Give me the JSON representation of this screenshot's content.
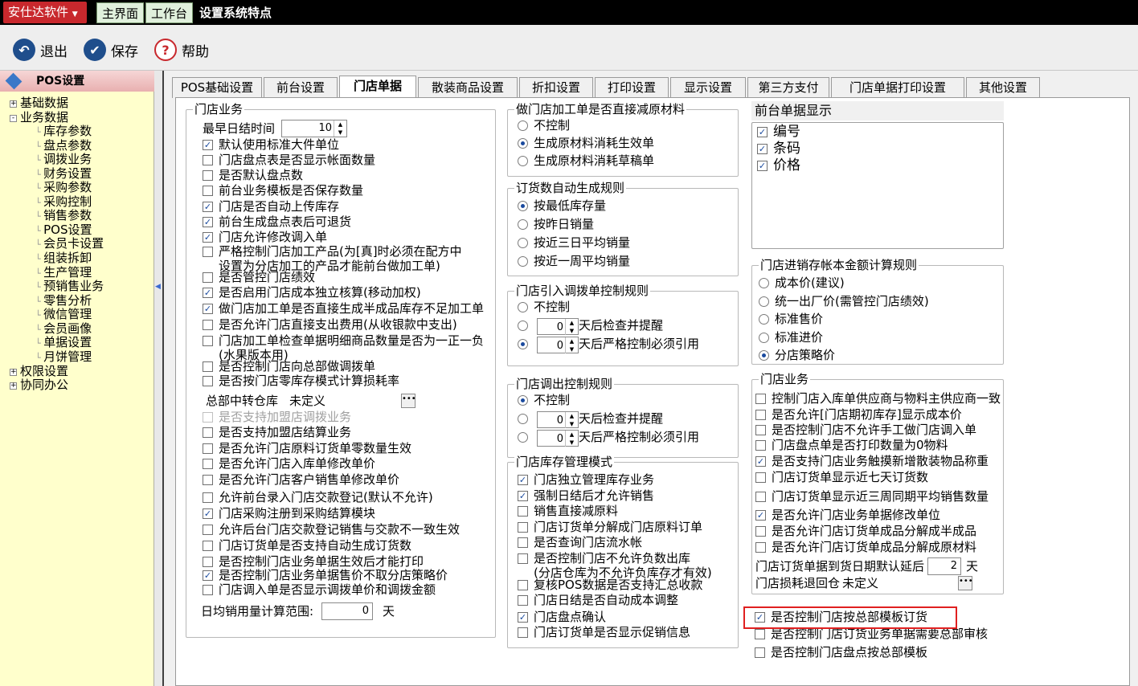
{
  "brand": "安仕达软件",
  "top_tabs": [
    "主界面",
    "工作台",
    "设置系统特点"
  ],
  "toolbar": {
    "exit": "退出",
    "save": "保存",
    "help": "帮助"
  },
  "left_panel": {
    "title": "POS设置",
    "tree": [
      {
        "label": "基础数据",
        "expander": "+",
        "level": 0
      },
      {
        "label": "业务数据",
        "expander": "-",
        "level": 0
      },
      {
        "label": "库存参数",
        "level": 1
      },
      {
        "label": "盘点参数",
        "level": 1
      },
      {
        "label": "调拨业务",
        "level": 1
      },
      {
        "label": "财务设置",
        "level": 1
      },
      {
        "label": "采购参数",
        "level": 1
      },
      {
        "label": "采购控制",
        "level": 1
      },
      {
        "label": "销售参数",
        "level": 1
      },
      {
        "label": "POS设置",
        "level": 1
      },
      {
        "label": "会员卡设置",
        "level": 1
      },
      {
        "label": "组装拆卸",
        "level": 1
      },
      {
        "label": "生产管理",
        "level": 1
      },
      {
        "label": "预销售业务",
        "level": 1
      },
      {
        "label": "零售分析",
        "level": 1
      },
      {
        "label": "微信管理",
        "level": 1
      },
      {
        "label": "会员画像",
        "level": 1
      },
      {
        "label": "单据设置",
        "level": 1
      },
      {
        "label": "月饼管理",
        "level": 1
      },
      {
        "label": "权限设置",
        "expander": "+",
        "level": 0
      },
      {
        "label": "协同办公",
        "expander": "+",
        "level": 0
      }
    ]
  },
  "tabs": [
    "POS基础设置",
    "前台设置",
    "门店单据",
    "散装商品设置",
    "折扣设置",
    "打印设置",
    "显示设置",
    "第三方支付",
    "门店单据打印设置",
    "其他设置"
  ],
  "active_tab": "门店单据",
  "store_business": {
    "title": "门店业务",
    "earliest_label": "最早日结时间",
    "earliest_value": "10",
    "opts": [
      {
        "t": "默认使用标准大件单位",
        "c": true
      },
      {
        "t": "门店盘点表是否显示帐面数量",
        "c": false
      },
      {
        "t": "是否默认盘点数",
        "c": false
      },
      {
        "t": "前台业务模板是否保存数量",
        "c": false
      },
      {
        "t": "门店是否自动上传库存",
        "c": true
      },
      {
        "t": "前台生成盘点表后可退货",
        "c": true
      },
      {
        "t": "门店允许修改调入单",
        "c": true
      },
      {
        "t": "严格控制门店加工产品(为[真]时必须在配方中\n设置为分店加工的产品才能前台做加工单)",
        "c": false
      },
      {
        "t": "是否管控门店绩效",
        "c": false
      },
      {
        "t": "是否启用门店成本独立核算(移动加权)",
        "c": true
      },
      {
        "t": "做门店加工单是否直接生成半成品库存不足加工单",
        "c": true
      },
      {
        "t": "是否允许门店直接支出费用(从收银款中支出)",
        "c": false
      },
      {
        "t": "门店加工单检查单据明细商品数量是否为一正一负\n(水果版本用)",
        "c": false
      },
      {
        "t": "是否控制门店向总部做调拨单",
        "c": false
      },
      {
        "t": "是否按门店零库存模式计算损耗率",
        "c": false
      }
    ],
    "transit_label": "总部中转仓库",
    "transit_value": "未定义",
    "opts2": [
      {
        "t": "是否支持加盟店调拨业务",
        "c": false,
        "d": true
      },
      {
        "t": "是否支持加盟店结算业务",
        "c": false
      },
      {
        "t": "是否允许门店原料订货单零数量生效",
        "c": false
      },
      {
        "t": "是否允许门店入库单修改单价",
        "c": false
      },
      {
        "t": "是否允许门店客户销售单修改单价",
        "c": false
      },
      {
        "t": "允许前台录入门店交款登记(默认不允许)",
        "c": false
      },
      {
        "t": "门店采购注册到采购结算模块",
        "c": true
      },
      {
        "t": "允许后台门店交款登记销售与交款不一致生效",
        "c": false
      },
      {
        "t": "门店订货单是否支持自动生成订货数",
        "c": false
      },
      {
        "t": "是否控制门店业务单据生效后才能打印",
        "c": false
      },
      {
        "t": "是否控制门店业务单据售价不取分店策略价",
        "c": true
      },
      {
        "t": "门店调入单是否显示调拨单价和调拨金额",
        "c": false
      }
    ],
    "daily_label": "日均销用量计算范围:",
    "daily_value": "0",
    "daily_unit": "天"
  },
  "processing": {
    "title": "做门店加工单是否直接减原材料",
    "opts": [
      {
        "t": "不控制",
        "on": false
      },
      {
        "t": "生成原材料消耗生效单",
        "on": true
      },
      {
        "t": "生成原材料消耗草稿单",
        "on": false
      }
    ]
  },
  "order_rule": {
    "title": "订货数自动生成规则",
    "opts": [
      {
        "t": "按最低库存量",
        "on": true
      },
      {
        "t": "按昨日销量",
        "on": false
      },
      {
        "t": "按近三日平均销量",
        "on": false
      },
      {
        "t": "按近一周平均销量",
        "on": false
      }
    ]
  },
  "transfer_in": {
    "title": "门店引入调拨单控制规则",
    "opt0": "不控制",
    "v1": "0",
    "t1": "天后检查并提醒",
    "v2": "0",
    "t2": "天后严格控制必须引用",
    "sel": 2
  },
  "transfer_out": {
    "title": "门店调出控制规则",
    "opt0": "不控制",
    "v1": "0",
    "t1": "天后检查并提醒",
    "v2": "0",
    "t2": "天后严格控制必须引用",
    "sel": 0
  },
  "inventory_mode": {
    "title": "门店库存管理模式",
    "opts": [
      {
        "t": "门店独立管理库存业务",
        "c": true
      },
      {
        "t": "强制日结后才允许销售",
        "c": true
      },
      {
        "t": "销售直接减原料",
        "c": false
      },
      {
        "t": "门店订货单分解成门店原料订单",
        "c": false
      },
      {
        "t": "是否查询门店流水帐",
        "c": false
      },
      {
        "t": "是否控制门店不允许负数出库\n(分店仓库为不允许负库存才有效)",
        "c": false
      },
      {
        "t": "复核POS数据是否支持汇总收款",
        "c": false
      },
      {
        "t": "门店日结是否自动成本调整",
        "c": false
      },
      {
        "t": "门店盘点确认",
        "c": true
      },
      {
        "t": "门店订货单是否显示促销信息",
        "c": false
      }
    ]
  },
  "front_display": {
    "title": "前台单据显示",
    "items": [
      {
        "t": "编号",
        "c": true
      },
      {
        "t": "条码",
        "c": true
      },
      {
        "t": "价格",
        "c": true
      }
    ]
  },
  "cost_rule": {
    "title": "门店进销存帐本金额计算规则",
    "opts": [
      {
        "t": "成本价(建议)",
        "on": false
      },
      {
        "t": "统一出厂价(需管控门店绩效)",
        "on": false
      },
      {
        "t": "标准售价",
        "on": false
      },
      {
        "t": "标准进价",
        "on": false
      },
      {
        "t": "分店策略价",
        "on": true
      }
    ]
  },
  "store_biz2": {
    "title": "门店业务",
    "opts": [
      {
        "t": "控制门店入库单供应商与物料主供应商一致",
        "c": false
      },
      {
        "t": "是否允许[门店期初库存]显示成本价",
        "c": false
      },
      {
        "t": "是否控制门店不允许手工做门店调入单",
        "c": false
      },
      {
        "t": "门店盘点单是否打印数量为0物料",
        "c": false
      },
      {
        "t": "是否支持门店业务触摸新增散装物品称重",
        "c": true
      },
      {
        "t": "门店订货单显示近七天订货数",
        "c": false
      },
      {
        "t": "门店订货单显示近三周同期平均销售数量",
        "c": false
      },
      {
        "t": "是否允许门店业务单据修改单位",
        "c": true
      },
      {
        "t": "是否允许门店订货单成品分解成半成品",
        "c": false
      },
      {
        "t": "是否允许门店订货单成品分解成原材料",
        "c": false
      }
    ],
    "delay_label": "门店订货单据到货日期默认延后",
    "delay_value": "2",
    "delay_unit": "天",
    "return_label": "门店损耗退回仓",
    "return_value": "未定义"
  },
  "bottom_opts": [
    {
      "t": "是否控制门店按总部模板订货",
      "c": true
    },
    {
      "t": "是否控制门店订货业务单据需要总部审核",
      "c": false
    },
    {
      "t": "是否控制门店盘点按总部模板",
      "c": false
    }
  ],
  "colors": {
    "brand_red": "#c8282d",
    "left_panel_bg": "#ffffcc",
    "highlight": "#e02020"
  }
}
